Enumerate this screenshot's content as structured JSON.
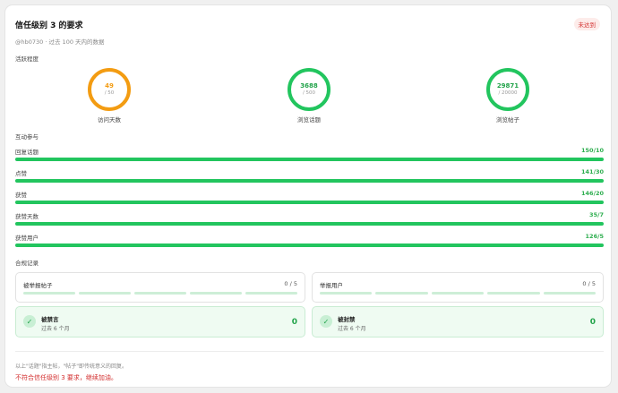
{
  "header": {
    "title": "信任级别 3 的要求",
    "badge": "未达到",
    "subtitle": "@hb0730 · 过去 100 天内的数据"
  },
  "activity": {
    "title": "活跃程度",
    "items": [
      {
        "value": "49",
        "target": "/ 50",
        "label": "访问天数",
        "color": "#f39c12"
      },
      {
        "value": "3688",
        "target": "/ 500",
        "label": "浏览话题",
        "color": "#22c55e"
      },
      {
        "value": "29871",
        "target": "/ 20000",
        "label": "浏览帖子",
        "color": "#22c55e"
      }
    ]
  },
  "interaction": {
    "title": "互动参与",
    "items": [
      {
        "label": "回复话题",
        "value": "150/10",
        "progress": 1.0
      },
      {
        "label": "点赞",
        "value": "141/30",
        "progress": 1.0
      },
      {
        "label": "获赞",
        "value": "146/20",
        "progress": 1.0
      },
      {
        "label": "获赞天数",
        "value": "35/7",
        "progress": 1.0
      },
      {
        "label": "获赞用户",
        "value": "126/5",
        "progress": 1.0
      }
    ]
  },
  "compliance": {
    "title": "合规记录",
    "reported_posts": {
      "label": "被举报帖子",
      "value": "0 / 5"
    },
    "reported_users": {
      "label": "举报用户",
      "value": "0 / 5"
    },
    "silenced": {
      "title": "被禁言",
      "sub": "过去 6 个月",
      "value": "0"
    },
    "suspended": {
      "title": "被封禁",
      "sub": "过去 6 个月",
      "value": "0"
    }
  },
  "footer": {
    "note": "以上\"话题\"指主帖，\"帖子\"即传统意义的回复。",
    "warning": "不符合信任级别 3 要求，继续加油。"
  }
}
